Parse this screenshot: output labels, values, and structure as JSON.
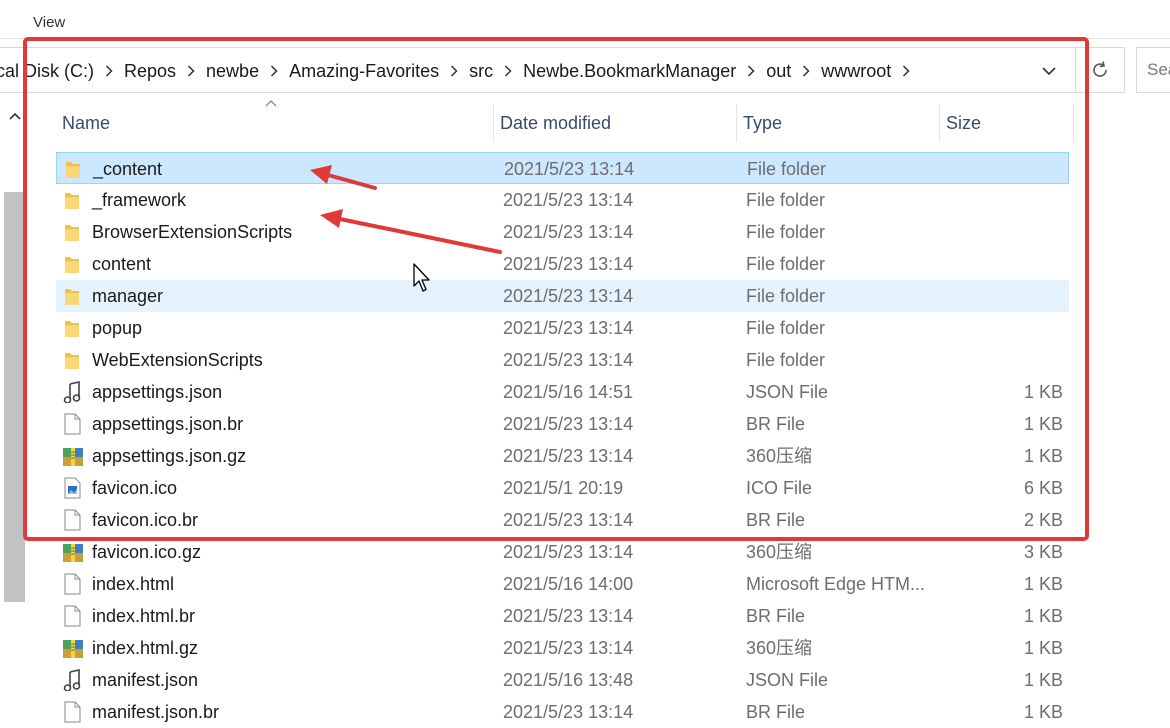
{
  "menu": {
    "view_label": "View"
  },
  "address_bar": {
    "crumbs": [
      "cal Disk (C:)",
      "Repos",
      "newbe",
      "Amazing-Favorites",
      "src",
      "Newbe.BookmarkManager",
      "out",
      "wwwroot"
    ]
  },
  "search": {
    "placeholder": "Sea"
  },
  "columns": {
    "name": "Name",
    "date": "Date modified",
    "type": "Type",
    "size": "Size"
  },
  "files": [
    {
      "icon": "folder-icon",
      "name": "_content",
      "date": "2021/5/23 13:14",
      "type": "File folder",
      "size": "",
      "state": "selected"
    },
    {
      "icon": "folder-icon",
      "name": "_framework",
      "date": "2021/5/23 13:14",
      "type": "File folder",
      "size": ""
    },
    {
      "icon": "folder-icon",
      "name": "BrowserExtensionScripts",
      "date": "2021/5/23 13:14",
      "type": "File folder",
      "size": ""
    },
    {
      "icon": "folder-icon",
      "name": "content",
      "date": "2021/5/23 13:14",
      "type": "File folder",
      "size": ""
    },
    {
      "icon": "folder-icon",
      "name": "manager",
      "date": "2021/5/23 13:14",
      "type": "File folder",
      "size": "",
      "state": "hover"
    },
    {
      "icon": "folder-icon",
      "name": "popup",
      "date": "2021/5/23 13:14",
      "type": "File folder",
      "size": ""
    },
    {
      "icon": "folder-icon",
      "name": "WebExtensionScripts",
      "date": "2021/5/23 13:14",
      "type": "File folder",
      "size": ""
    },
    {
      "icon": "json-file-icon",
      "name": "appsettings.json",
      "date": "2021/5/16 14:51",
      "type": "JSON File",
      "size": "1 KB"
    },
    {
      "icon": "blank-file-icon",
      "name": "appsettings.json.br",
      "date": "2021/5/23 13:14",
      "type": "BR File",
      "size": "1 KB"
    },
    {
      "icon": "archive-file-icon",
      "name": "appsettings.json.gz",
      "date": "2021/5/23 13:14",
      "type": "360压缩",
      "size": "1 KB"
    },
    {
      "icon": "image-file-icon",
      "name": "favicon.ico",
      "date": "2021/5/1 20:19",
      "type": "ICO File",
      "size": "6 KB"
    },
    {
      "icon": "blank-file-icon",
      "name": "favicon.ico.br",
      "date": "2021/5/23 13:14",
      "type": "BR File",
      "size": "2 KB"
    },
    {
      "icon": "archive-file-icon",
      "name": "favicon.ico.gz",
      "date": "2021/5/23 13:14",
      "type": "360压缩",
      "size": "3 KB"
    },
    {
      "icon": "blank-file-icon",
      "name": "index.html",
      "date": "2021/5/16 14:00",
      "type": "Microsoft Edge HTM...",
      "size": "1 KB"
    },
    {
      "icon": "blank-file-icon",
      "name": "index.html.br",
      "date": "2021/5/23 13:14",
      "type": "BR File",
      "size": "1 KB"
    },
    {
      "icon": "archive-file-icon",
      "name": "index.html.gz",
      "date": "2021/5/23 13:14",
      "type": "360压缩",
      "size": "1 KB"
    },
    {
      "icon": "json-file-icon",
      "name": "manifest.json",
      "date": "2021/5/16 13:48",
      "type": "JSON File",
      "size": "1 KB"
    },
    {
      "icon": "blank-file-icon",
      "name": "manifest.json.br",
      "date": "2021/5/23 13:14",
      "type": "BR File",
      "size": "1 KB"
    }
  ],
  "colors": {
    "selection": "#cce8ff",
    "hover": "#e5f3ff",
    "annotation": "#e0393a",
    "folder": "#f8d775"
  }
}
